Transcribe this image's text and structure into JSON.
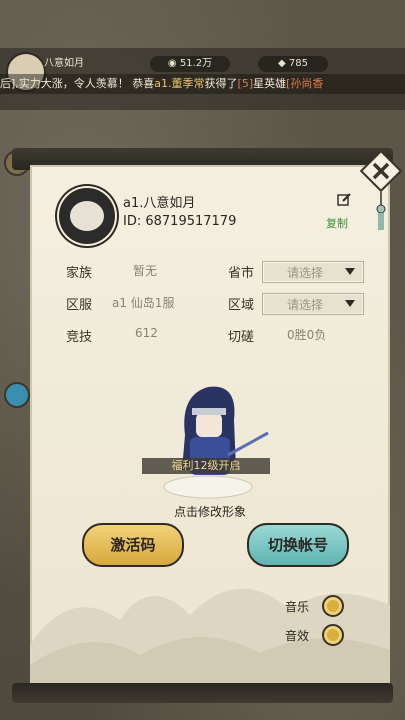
{
  "top": {
    "player_name": "八意如月",
    "resource1": "51.2万",
    "resource2": "785",
    "ticker_parts": [
      {
        "text": "后],实力大涨，令人羡慕！    恭喜",
        "cls": ""
      },
      {
        "text": "a1.董季常",
        "cls": "hl"
      },
      {
        "text": "获得了",
        "cls": ""
      },
      {
        "text": "[5]",
        "cls": "red"
      },
      {
        "text": "星英雄",
        "cls": ""
      },
      {
        "text": "[孙尚香",
        "cls": "red"
      }
    ]
  },
  "profile": {
    "name": "a1.八意如月",
    "id": "ID: 68719517179",
    "copy_label": "复制"
  },
  "fields": {
    "clan_label": "家族",
    "clan_value": "暂无",
    "province_label": "省市",
    "province_placeholder": "请选择",
    "server_label": "区服",
    "server_value": "a1 仙岛1服",
    "region_label": "区域",
    "region_placeholder": "请选择",
    "arena_label": "竞技",
    "arena_value": "612",
    "spar_label": "切磋",
    "spar_value": "0胜0负"
  },
  "character": {
    "welfare_text": "福利12级开启",
    "modify_text": "点击修改形象"
  },
  "buttons": {
    "activate": "激活码",
    "switch_account": "切换帐号"
  },
  "options": {
    "music": "音乐",
    "sound": "音效"
  }
}
